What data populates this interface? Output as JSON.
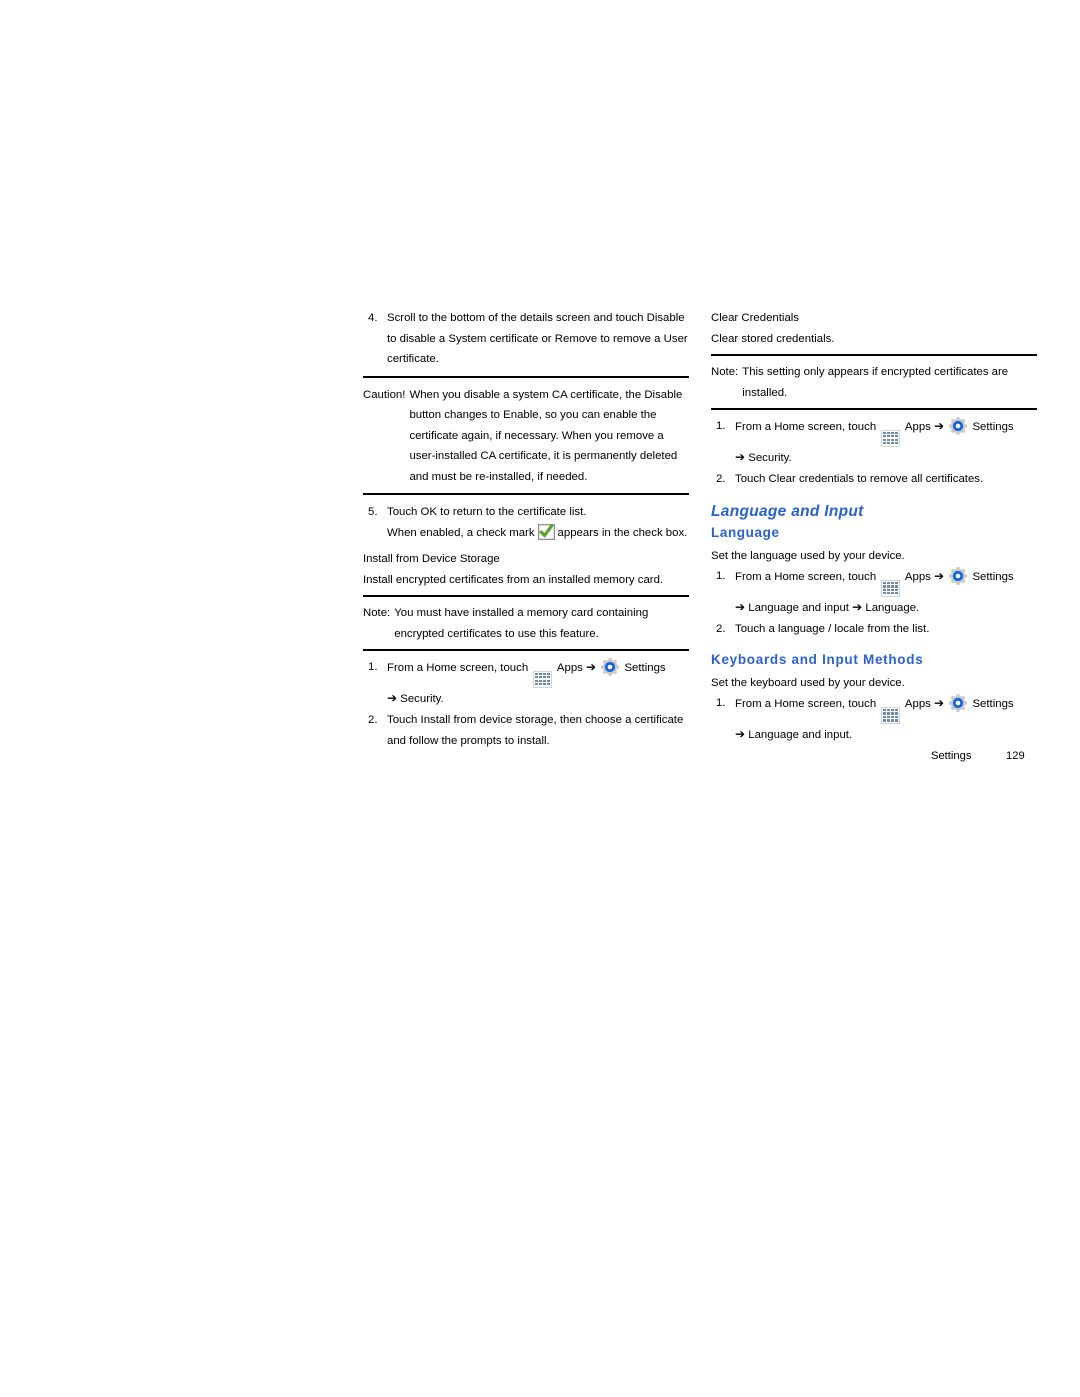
{
  "document": {
    "title": "Settings",
    "page_number": "129"
  },
  "icons": {
    "apps": "apps-grid-icon",
    "settings": "settings-gear-icon",
    "check": "green-checkmark-icon",
    "arrow": "➔"
  },
  "left_column": {
    "step4": {
      "num": "4.",
      "text": "Scroll to the bottom of the details screen and touch Disable to disable a System certificate or Remove to remove a User certificate."
    },
    "caution": {
      "lead": "Caution!",
      "text": "When you disable a system CA certificate, the Disable button changes to Enable, so you can enable the certificate again, if necessary. When you remove a user-installed CA certificate, it is permanently deleted and must be re-installed, if needed."
    },
    "step5": {
      "num": "5.",
      "text": "Touch OK to return to the certificate list.",
      "text_before_check": "When enabled, a check mark",
      "text_after_check": "appears in the check box."
    },
    "install_heading": "Install from Device Storage",
    "install_desc": "Install encrypted certificates from an installed memory card.",
    "note": {
      "lead": "Note:",
      "text": "You must have installed a memory card containing encrypted certificates to use this feature."
    },
    "steps": [
      {
        "num": "1.",
        "pre": "From a Home screen, touch",
        "apps_label": "Apps",
        "settings_label": "Settings",
        "cont": "Security."
      },
      {
        "num": "2.",
        "text": "Touch Install from device storage, then choose a certificate and follow the prompts to install."
      }
    ]
  },
  "right_column": {
    "clear_credentials_heading": "Clear Credentials",
    "clear_credentials_desc": "Clear stored credentials.",
    "note": {
      "lead": "Note:",
      "text": "This setting only appears if encrypted certificates are installed."
    },
    "clear_steps": [
      {
        "num": "1.",
        "pre": "From a Home screen, touch",
        "apps_label": "Apps",
        "settings_label": "Settings",
        "cont": "Security."
      },
      {
        "num": "2.",
        "text": "Touch Clear credentials to remove all certificates."
      }
    ],
    "language_and_input_heading": "Language and Input",
    "language_heading": "Language",
    "language_desc": "Set the language used by your device.",
    "language_steps": [
      {
        "num": "1.",
        "pre": "From a Home screen, touch",
        "apps_label": "Apps",
        "settings_label": "Settings",
        "cont": "Language and input",
        "cont2": "Language."
      },
      {
        "num": "2.",
        "text": "Touch a language / locale from the list."
      }
    ],
    "keyboards_heading": "Keyboards and Input Methods",
    "keyboards_desc": "Set the keyboard used by your device.",
    "keyboard_steps": [
      {
        "num": "1.",
        "pre": "From a Home screen, touch",
        "apps_label": "Apps",
        "settings_label": "Settings",
        "cont": "Language and input."
      }
    ]
  },
  "colors": {
    "heading_blue": "#2a62cf",
    "apps_icon": "#6e8aa8",
    "gear_blue": "#1565d8",
    "check_green": "#5aa02c"
  }
}
